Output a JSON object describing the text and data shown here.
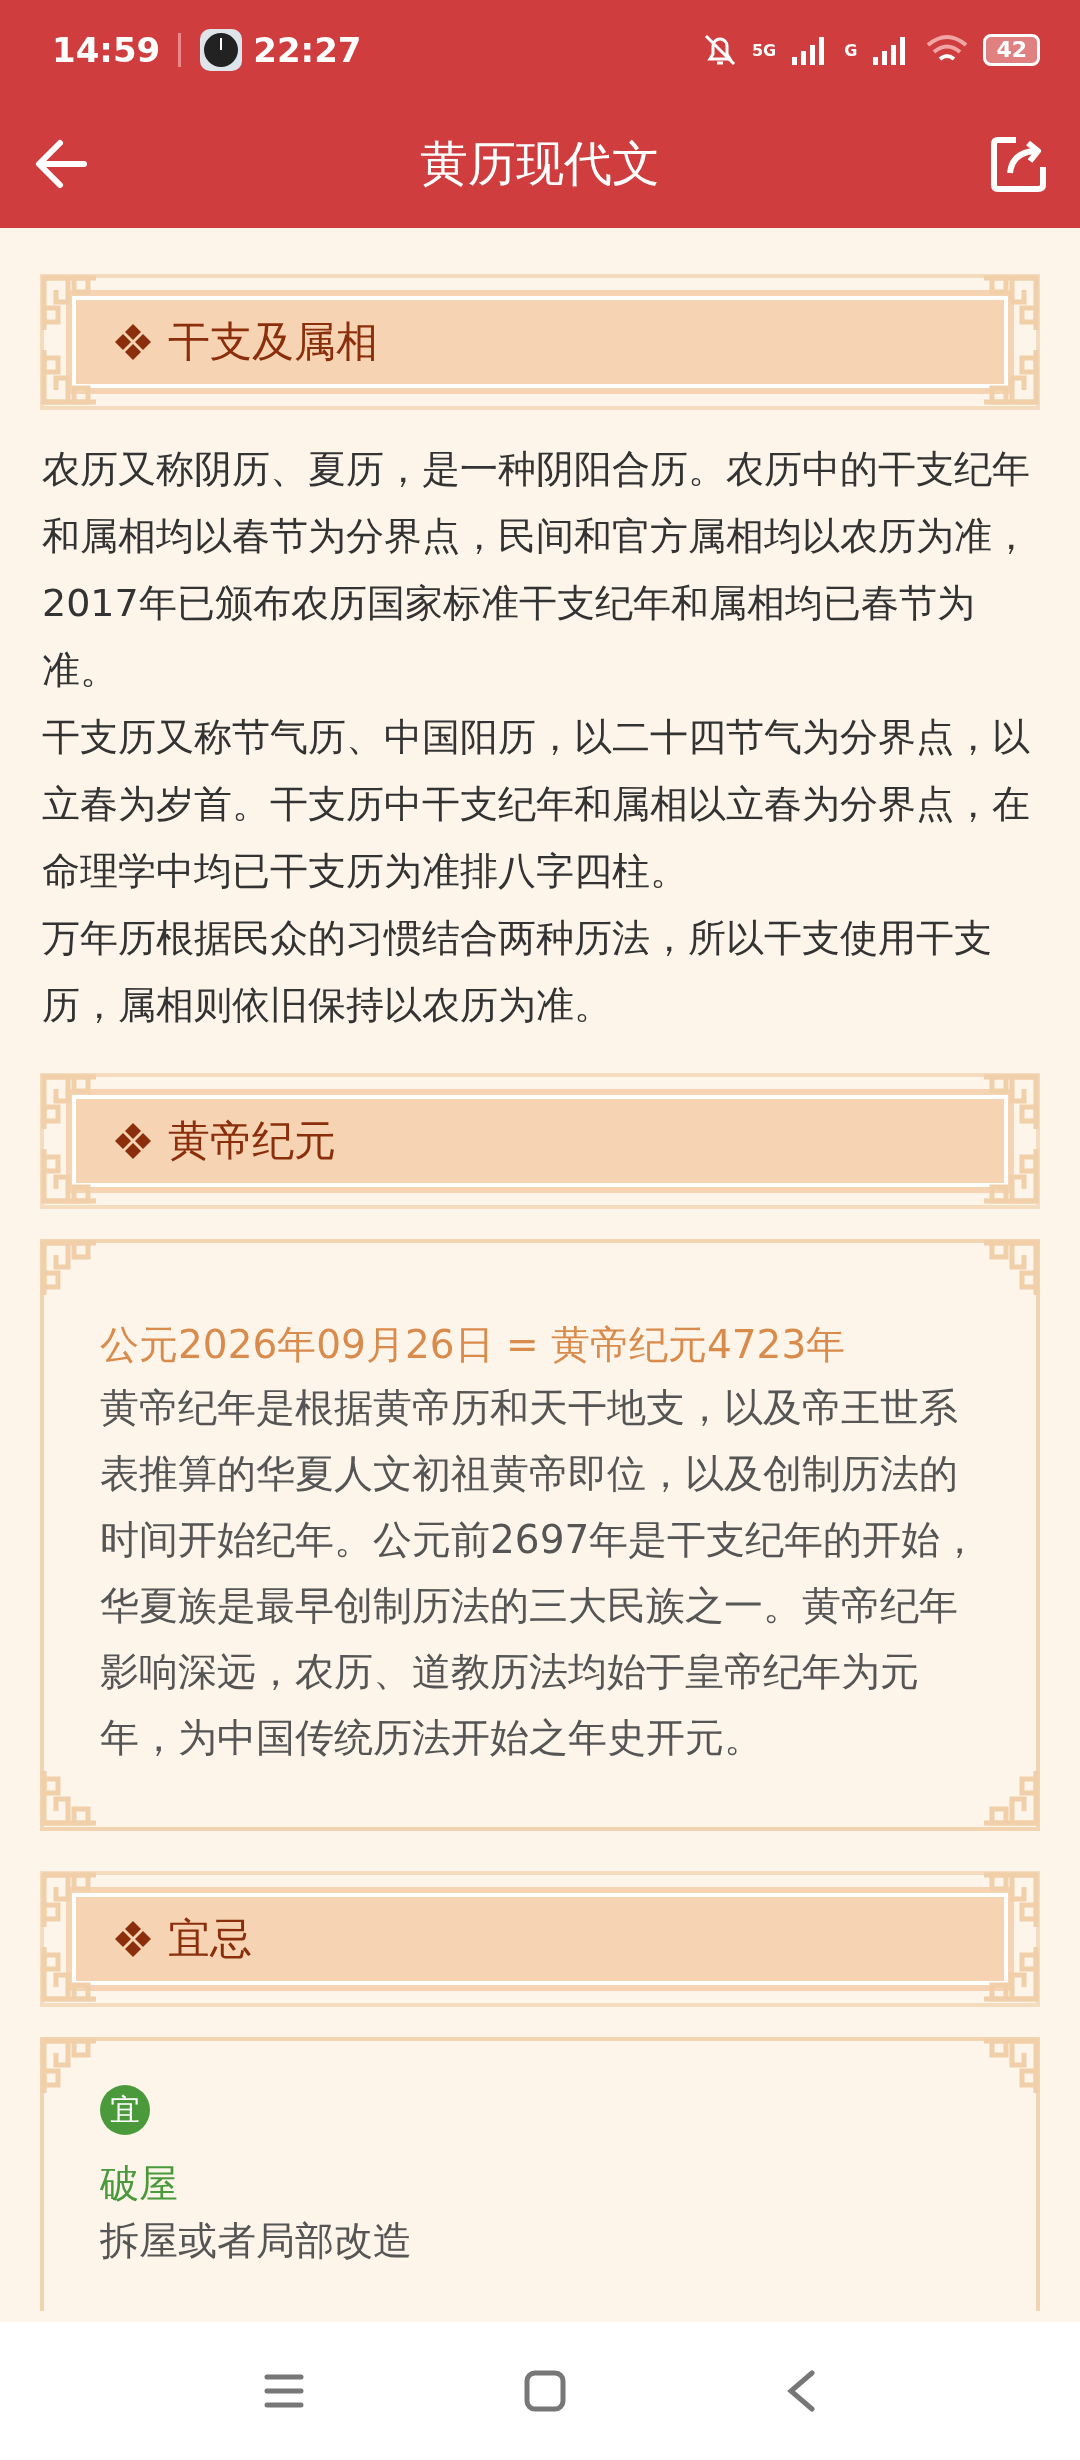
{
  "status_bar": {
    "time": "14:59",
    "clock_time": "22:27",
    "network_1": "5G",
    "network_2": "G",
    "battery": "42"
  },
  "app_bar": {
    "title": "黄历现代文"
  },
  "sections": [
    {
      "kind": "text",
      "title": "干支及属相",
      "paragraphs": [
        "农历又称阴历、夏历，是一种阴阳合历。农历中的干支纪年和属相均以春节为分界点，民间和官方属相均以农历为准，2017年已颁布农历国家标准干支纪年和属相均已春节为准。",
        "干支历又称节气历、中国阳历，以二十四节气为分界点，以立春为岁首。干支历中干支纪年和属相以立春为分界点，在命理学中均已干支历为准排八字四柱。",
        "万年历根据民众的习惯结合两种历法，所以干支使用干支历，属相则依旧保持以农历为准。"
      ]
    },
    {
      "kind": "card",
      "title": "黄帝纪元",
      "headline": "公元2026年09月26日 = 黄帝纪元4723年",
      "body": "黄帝纪年是根据黄帝历和天干地支，以及帝王世系表推算的华夏人文初祖黄帝即位，以及创制历法的时间开始纪年。公元前2697年是干支纪年的开始，华夏族是最早创制历法的三大民族之一。黄帝纪年影响深远，农历、道教历法均始于皇帝纪年为元年，为中国传统历法开始之年史开元。"
    },
    {
      "kind": "list",
      "title": "宜忌",
      "items": [
        {
          "badge": "宜",
          "name": "破屋",
          "description": "拆屋或者局部改造",
          "color": "#4a9a3c"
        }
      ]
    }
  ]
}
